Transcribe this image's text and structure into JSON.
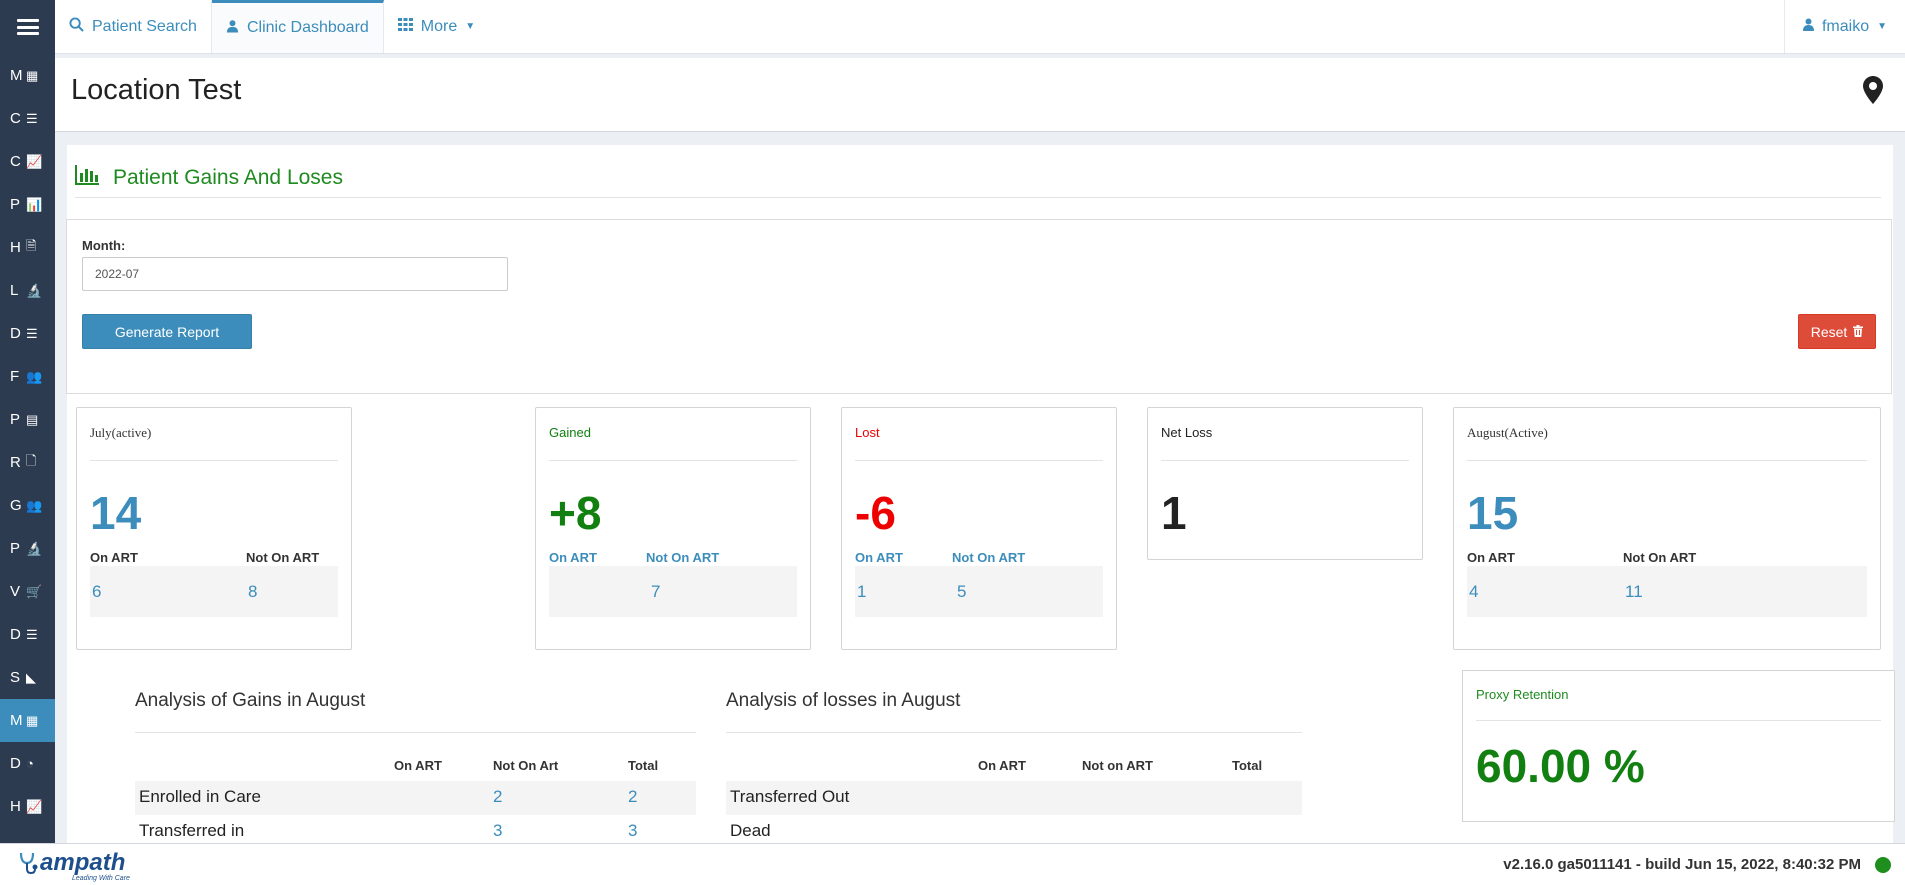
{
  "sidebar": {
    "items": [
      {
        "letter": "M",
        "icon": "sitemap-icon",
        "glyph": "▦"
      },
      {
        "letter": "C",
        "icon": "list-icon",
        "glyph": "☰"
      },
      {
        "letter": "C",
        "icon": "line-chart-icon",
        "glyph": "📈"
      },
      {
        "letter": "P",
        "icon": "bar-chart-icon",
        "glyph": "📊"
      },
      {
        "letter": "H",
        "icon": "pdf-icon",
        "glyph": "🗎"
      },
      {
        "letter": "L",
        "icon": "microscope-icon",
        "glyph": "🔬"
      },
      {
        "letter": "D",
        "icon": "list-icon",
        "glyph": "☰"
      },
      {
        "letter": "F",
        "icon": "users-icon",
        "glyph": "👥"
      },
      {
        "letter": "P",
        "icon": "id-card-icon",
        "glyph": "▤"
      },
      {
        "letter": "R",
        "icon": "file-icon",
        "glyph": "🗋"
      },
      {
        "letter": "G",
        "icon": "users-icon",
        "glyph": "👥"
      },
      {
        "letter": "P",
        "icon": "microscope-icon",
        "glyph": "🔬"
      },
      {
        "letter": "V",
        "icon": "cart-icon",
        "glyph": "🛒"
      },
      {
        "letter": "D",
        "icon": "list-icon",
        "glyph": "☰"
      },
      {
        "letter": "S",
        "icon": "area-chart-icon",
        "glyph": "◣"
      },
      {
        "letter": "M",
        "icon": "table-icon",
        "glyph": "▦",
        "active": true
      },
      {
        "letter": "D",
        "icon": "pie-chart-icon",
        "glyph": "◔"
      },
      {
        "letter": "H",
        "icon": "line-chart-icon",
        "glyph": "📈"
      }
    ]
  },
  "nav": {
    "patient_search": "Patient Search",
    "clinic_dashboard": "Clinic Dashboard",
    "more": "More",
    "user": "fmaiko"
  },
  "page": {
    "title": "Location Test"
  },
  "report": {
    "title": "Patient Gains And Loses",
    "month_label": "Month:",
    "month_value": "2022-07",
    "generate_label": "Generate Report",
    "reset_label": "Reset"
  },
  "cards": {
    "july": {
      "title": "July(active)",
      "value": "14",
      "on_art_label": "On ART",
      "not_on_art_label": "Not On ART",
      "on_art": "6",
      "not_on_art": "8"
    },
    "gained": {
      "title": "Gained",
      "value": "+8",
      "on_art_label": "On ART",
      "not_on_art_label": "Not On ART",
      "on_art": "",
      "not_on_art": "7"
    },
    "lost": {
      "title": "Lost",
      "value": "-6",
      "on_art_label": "On ART",
      "not_on_art_label": "Not On ART",
      "on_art": "1",
      "not_on_art": "5"
    },
    "net_loss": {
      "title": "Net Loss",
      "value": "1"
    },
    "august": {
      "title": "August(Active)",
      "value": "15",
      "on_art_label": "On ART",
      "not_on_art_label": "Not On ART",
      "on_art": "4",
      "not_on_art": "11"
    }
  },
  "gains_analysis": {
    "title": "Analysis of Gains in August",
    "headers": [
      "On ART",
      "Not On Art",
      "Total"
    ],
    "rows": [
      {
        "label": "Enrolled in Care",
        "on_art": "",
        "not_on_art": "2",
        "total": "2"
      },
      {
        "label": "Transferred in",
        "on_art": "",
        "not_on_art": "3",
        "total": "3"
      }
    ]
  },
  "losses_analysis": {
    "title": "Analysis of losses in August",
    "headers": [
      "On ART",
      "Not on ART",
      "Total"
    ],
    "rows": [
      {
        "label": "Transferred Out",
        "on_art": "",
        "not_on_art": "",
        "total": ""
      },
      {
        "label": "Dead",
        "on_art": "",
        "not_on_art": "",
        "total": ""
      }
    ]
  },
  "proxy": {
    "title": "Proxy Retention",
    "value": "60.00 %"
  },
  "footer": {
    "logo": "ampath",
    "tagline": "Leading With Care",
    "version": "v2.16.0 ga5011141 - build Jun 15, 2022, 8:40:32 PM",
    "status_color": "#1e8e1e"
  },
  "colors": {
    "sidebar": "#2c3b4f",
    "accent": "#3c8dbc",
    "green": "#118011",
    "red": "#ee0000",
    "reset": "#dd4b39"
  }
}
